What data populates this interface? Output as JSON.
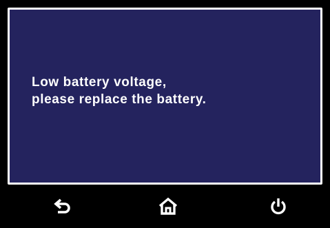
{
  "dialog": {
    "message_line1": "Low battery voltage,",
    "message_line2": "please replace the battery."
  },
  "navbar": {
    "back_icon": "back-arrow-icon",
    "home_icon": "home-icon",
    "power_icon": "power-icon"
  },
  "colors": {
    "screen_background": "#24235e",
    "screen_border": "#ffffff",
    "text": "#ffffff",
    "bezel": "#000000"
  }
}
